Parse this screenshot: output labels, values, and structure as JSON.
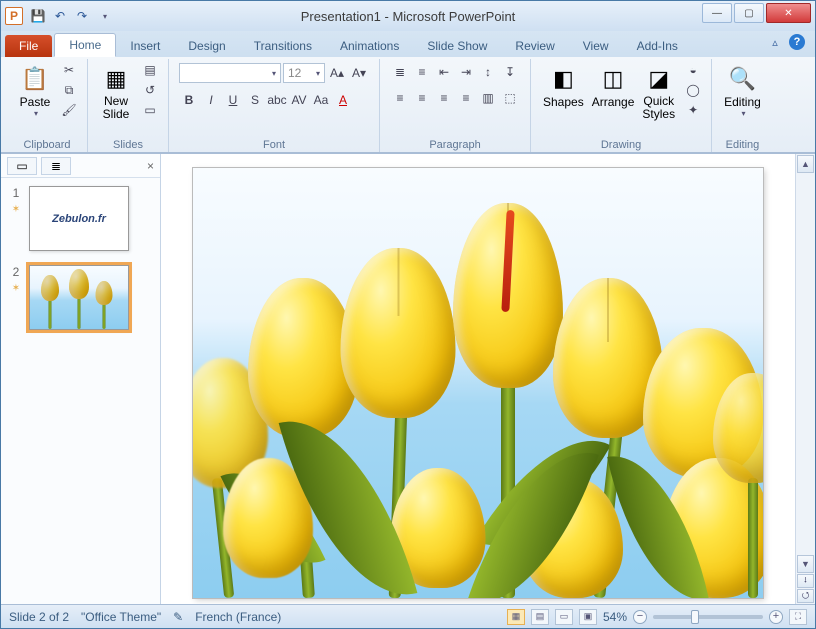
{
  "title": "Presentation1  -  Microsoft PowerPoint",
  "app_letter": "P",
  "tabs": {
    "file": "File",
    "home": "Home",
    "insert": "Insert",
    "design": "Design",
    "transitions": "Transitions",
    "animations": "Animations",
    "slideshow": "Slide Show",
    "review": "Review",
    "view": "View",
    "addins": "Add-Ins"
  },
  "ribbon": {
    "clipboard": {
      "label": "Clipboard",
      "paste": "Paste"
    },
    "slides": {
      "label": "Slides",
      "new_slide": "New\nSlide"
    },
    "font": {
      "label": "Font",
      "font_name": "",
      "font_size": "12"
    },
    "paragraph": {
      "label": "Paragraph"
    },
    "drawing": {
      "label": "Drawing",
      "shapes": "Shapes",
      "arrange": "Arrange",
      "quick_styles": "Quick\nStyles"
    },
    "editing": {
      "label": "Editing",
      "editing_btn": "Editing"
    }
  },
  "slides": [
    {
      "num": "1",
      "content": "Zebulon.fr"
    },
    {
      "num": "2",
      "content": "tulips"
    }
  ],
  "status": {
    "slide": "Slide 2 of 2",
    "theme": "\"Office Theme\"",
    "language": "French (France)",
    "zoom": "54%"
  }
}
